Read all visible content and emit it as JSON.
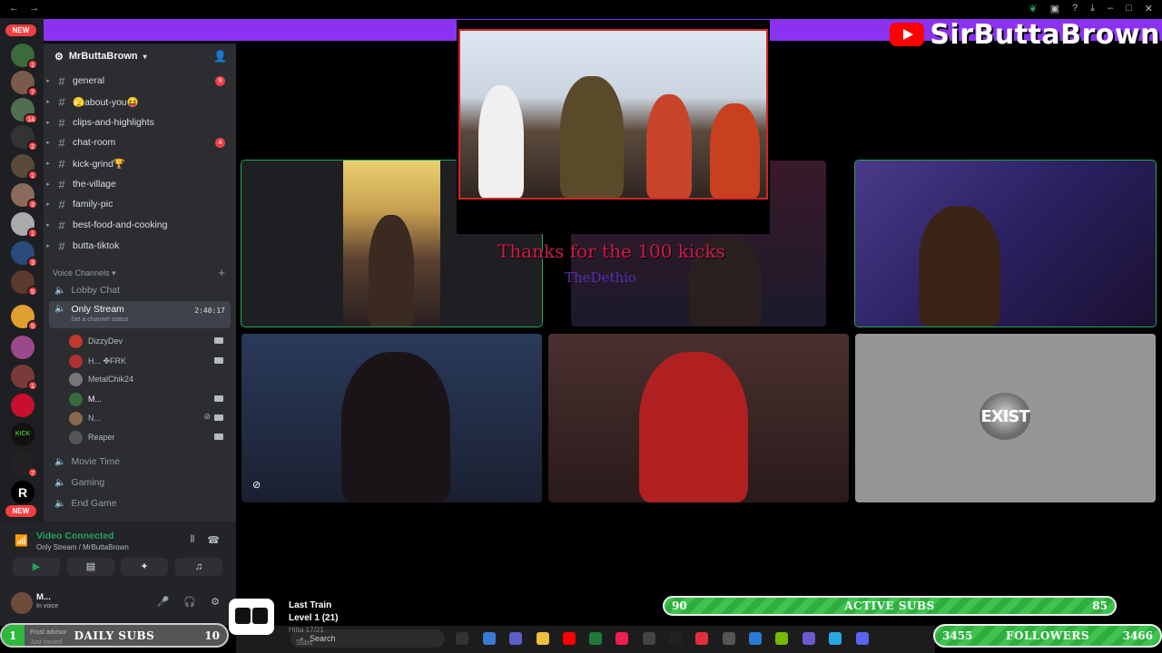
{
  "titlebar": {
    "back": "←",
    "forward": "→"
  },
  "brand": {
    "name": "SirButtaBrown"
  },
  "rail": {
    "new_top": "NEW",
    "new_bottom": "NEW",
    "badges": [
      "1",
      "7",
      "14",
      "2",
      "1",
      "3",
      "1",
      "3",
      "5",
      "5",
      "1",
      "7",
      "1"
    ]
  },
  "server": {
    "name": "MrButtaBrown"
  },
  "channels": [
    {
      "name": "general",
      "badge": "9"
    },
    {
      "name": "🫣about-you😝",
      "badge": ""
    },
    {
      "name": "clips-and-highlights",
      "badge": ""
    },
    {
      "name": "chat-room",
      "badge": "4"
    },
    {
      "name": "kick-grind🏆",
      "badge": ""
    },
    {
      "name": "the-village",
      "badge": ""
    },
    {
      "name": "family-pic",
      "badge": ""
    },
    {
      "name": "best-food-and-cooking",
      "badge": ""
    },
    {
      "name": "butta-tiktok",
      "badge": ""
    }
  ],
  "voice_category": "Voice Channels",
  "voice_channels": {
    "lobby": "Lobby Chat",
    "active": "Only Stream",
    "active_timer": "2:40:17",
    "active_status": "Set a channel status",
    "movie": "Movie Time",
    "gaming": "Gaming",
    "endgame": "End Game"
  },
  "voice_users": [
    "DizzyDev",
    "H... ✤FRK",
    "MetalChik24",
    "M...",
    "N...",
    "Reaper"
  ],
  "voice_panel": {
    "title": "Video Connected",
    "sub": "Only Stream / MrButtaBrown"
  },
  "user_panel": {
    "name": "M...",
    "status": "In voice"
  },
  "stream_overlay": {
    "thanks": "Thanks for the 100 kicks",
    "name": "TheDethio"
  },
  "exist_logo": "EXIST",
  "last_train": {
    "title": "Last Train",
    "level": "Level 1  (21)",
    "small1": "Hitta 17/21",
    "small2": "Subs"
  },
  "taskbar": {
    "search": "Search"
  },
  "goals": {
    "daily": {
      "label": "DAILY SUBS",
      "current": "1",
      "target": "10",
      "progress": 0.1
    },
    "active": {
      "label": "ACTIVE SUBS",
      "current": "90",
      "target": "85"
    },
    "followers": {
      "label": "FOLLOWERS",
      "current": "3455",
      "target": "3466"
    },
    "frost": {
      "line1": "Frost advisor",
      "line2": "Just issued"
    }
  },
  "colors": {
    "accent": "#8b32f2",
    "discord_green": "#23a55a",
    "badge_red": "#f23f43",
    "goal_green": "#2fae3f"
  }
}
